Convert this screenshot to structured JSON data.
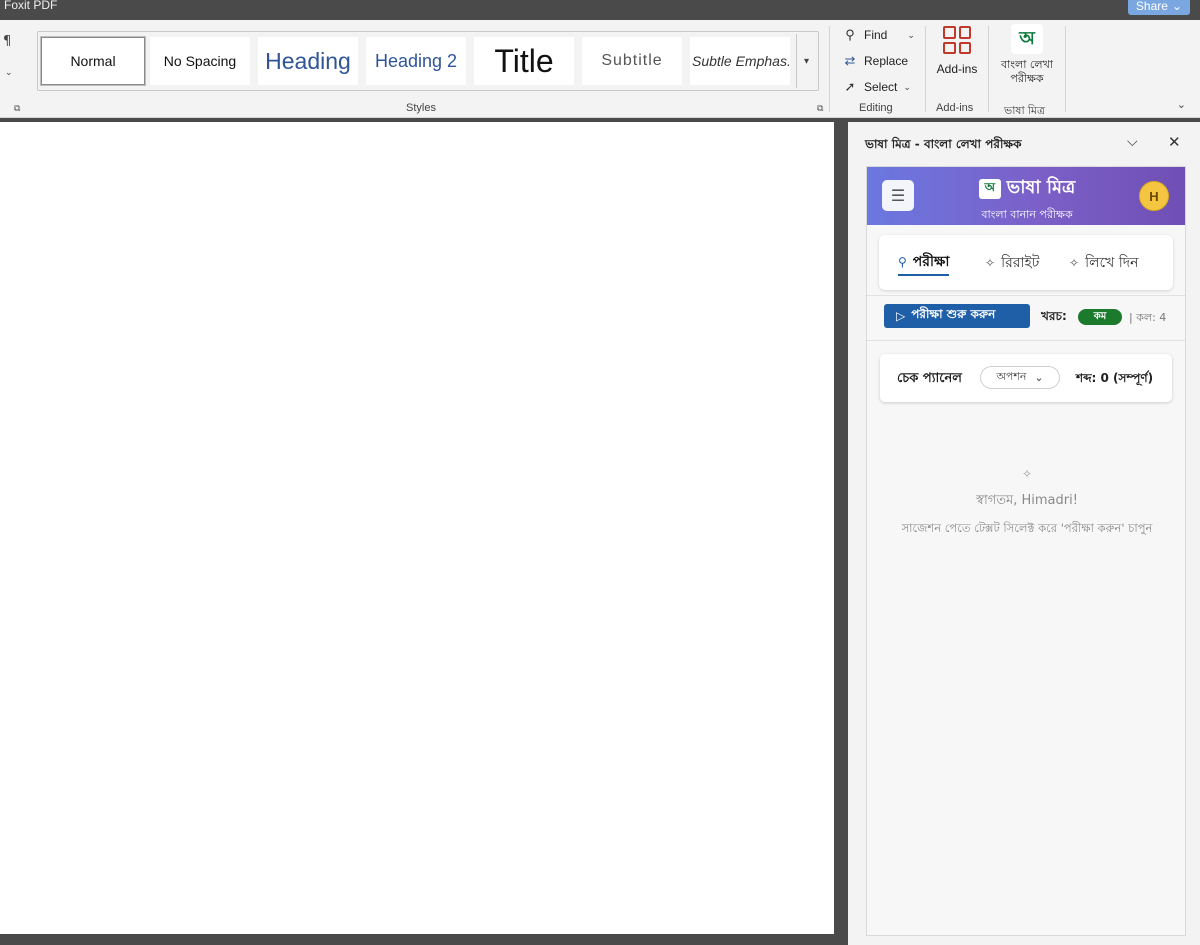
{
  "window": {
    "tab_label": "Foxit PDF",
    "share_label": "Share"
  },
  "ribbon": {
    "styles": [
      {
        "label": "Normal"
      },
      {
        "label": "No Spacing"
      },
      {
        "label": "Heading"
      },
      {
        "label": "Heading 2"
      },
      {
        "label": "Title"
      },
      {
        "label": "Subtitle"
      },
      {
        "label": "Subtle Emphas..."
      }
    ],
    "styles_group_label": "Styles",
    "editing": {
      "find": "Find",
      "replace": "Replace",
      "select": "Select",
      "group_label": "Editing"
    },
    "addins": {
      "button_label": "Add-ins",
      "group_label": "Add-ins"
    },
    "bhasha": {
      "button_line1": "বাংলা লেখা",
      "button_line2": "পরীক্ষক",
      "group_label": "ভাষা মিত্র",
      "logo_text": "অ"
    }
  },
  "pane": {
    "title": "ভাষা মিত্র - বাংলা লেখা পরীক্ষক",
    "app": {
      "brand_name": "ভাষা মিত্র",
      "brand_subtitle": "বাংলা বানান পরীক্ষক",
      "logo_text": "অ",
      "avatar_initial": "H",
      "tabs": [
        {
          "label": "পরীক্ষা",
          "icon": "search-icon",
          "active": true
        },
        {
          "label": "রিরাইট",
          "icon": "sparkle-icon",
          "active": false
        },
        {
          "label": "লিখে দিন",
          "icon": "sparkle-icon",
          "active": false
        }
      ],
      "start_button": "পরীক্ষা শুরু করুন",
      "cost_label": "খরচ:",
      "cost_value": "কম",
      "calls": "| কল: 4",
      "check_panel_title": "চেক প্যানেল",
      "options_label": "অপশন",
      "word_count": "শব্দ: 0 (সম্পূর্ণ)",
      "welcome": "স্বাগতম, Himadri!",
      "hint": "সাজেশন পেতে টেক্সট সিলেক্ট করে 'পরীক্ষা করুন' চাপুন"
    }
  },
  "colors": {
    "accent_blue": "#1f5fa8",
    "header_gradient_start": "#6a78e0",
    "header_gradient_end": "#6f4fb4",
    "cost_badge_green": "#1b7a2c",
    "avatar_yellow": "#f4c541"
  }
}
